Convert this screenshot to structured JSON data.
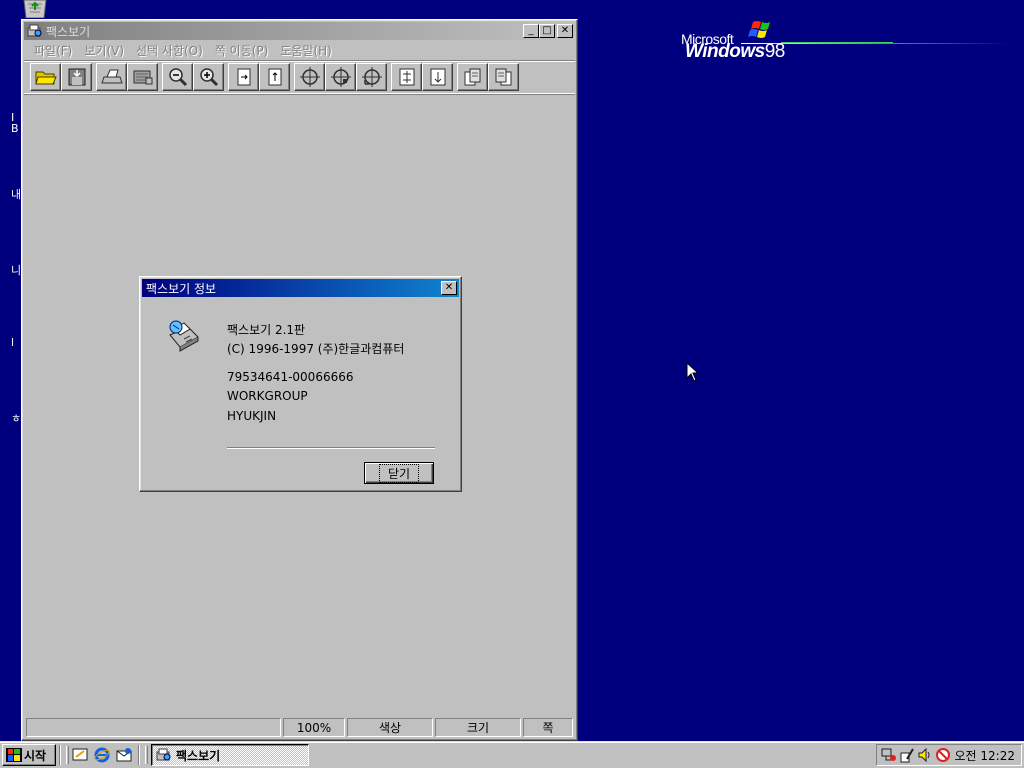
{
  "desktop": {
    "side_labels": [
      "I\nB",
      "내",
      "니",
      "l",
      "ㅎ"
    ],
    "logo": {
      "brand": "Microsoft",
      "product": "Windows",
      "version": "98"
    }
  },
  "main_window": {
    "title": "팩스보기",
    "controls": {
      "minimize": "_",
      "maximize": "□",
      "close": "✕"
    },
    "menu": [
      "파일(F)",
      "보기(V)",
      "선택 사항(O)",
      "쪽 이동(P)",
      "도움말(H)"
    ],
    "toolbar_groups": [
      [
        "open-icon",
        "save-icon"
      ],
      [
        "print-icon",
        "print-setup-icon"
      ],
      [
        "zoom-out-icon",
        "zoom-in-icon"
      ],
      [
        "rotate-left-icon",
        "rotate-right-icon"
      ],
      [
        "crosshair-icon",
        "crosshair-center-icon",
        "crosshair-fit-icon"
      ],
      [
        "flip-horizontal-icon",
        "flip-vertical-icon"
      ],
      [
        "previous-page-icon",
        "next-page-icon"
      ]
    ],
    "status": {
      "message": "",
      "zoom": "100%",
      "color": "색상",
      "size": "크기",
      "page": "쪽"
    }
  },
  "about_dialog": {
    "title": "팩스보기 정보",
    "close": "✕",
    "product_line": "팩스보기 2.1판",
    "copyright_line": "(C) 1996-1997 (주)한글과컴퓨터",
    "serial": "79534641-00066666",
    "workgroup": "WORKGROUP",
    "user": "HYUKJIN",
    "ok_label": "닫기"
  },
  "taskbar": {
    "start_label": "시작",
    "quick_launch": [
      "desktop-icon",
      "internet-explorer-icon",
      "outlook-icon"
    ],
    "task_label": "팩스보기",
    "tray_icons": [
      "network-icon",
      "pen-icon",
      "volume-icon",
      "block-icon"
    ],
    "clock": "오전 12:22"
  }
}
